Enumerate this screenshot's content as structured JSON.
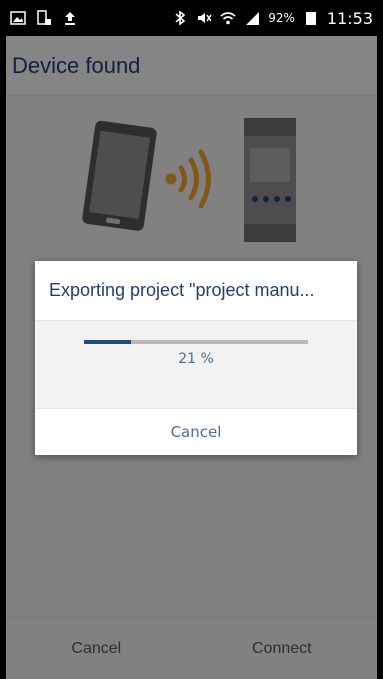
{
  "status_bar": {
    "icons_left": [
      "image-icon",
      "screen-share-icon",
      "upload-icon"
    ],
    "icons_right": [
      "bluetooth-icon",
      "mute-icon",
      "wifi-icon",
      "signal-icon"
    ],
    "battery": "92%",
    "time": "11:53"
  },
  "header": {
    "title": "Device found"
  },
  "bottom_bar": {
    "cancel_label": "Cancel",
    "connect_label": "Connect"
  },
  "dialog": {
    "title": "Exporting project \"project manu...",
    "progress_percent": 21,
    "progress_text": "21 %",
    "cancel_label": "Cancel"
  },
  "colors": {
    "brand_blue": "#1f3f73",
    "progress_fill": "#1f4e7d",
    "wifi_orange": "#e8a030"
  }
}
